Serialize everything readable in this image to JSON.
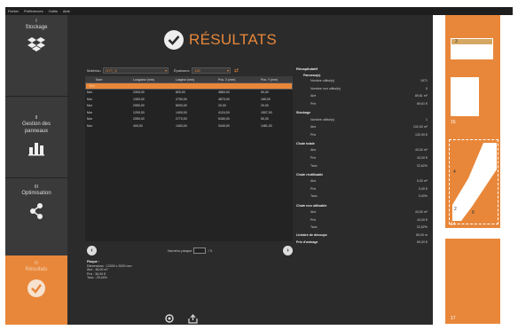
{
  "menubar": [
    "Fichier",
    "Préférences",
    "Outils",
    "Aide"
  ],
  "sidebar": {
    "items": [
      {
        "num": "I",
        "label": "Stockage",
        "icon": "dropbox-box-icon"
      },
      {
        "num": "II",
        "label": "Gestion des panneaux",
        "icon": "bar-chart-icon"
      },
      {
        "num": "III",
        "label": "Optimisation",
        "icon": "share-nodes-icon"
      },
      {
        "num": "IV",
        "label": "Résultats",
        "icon": "check-circle-icon"
      }
    ]
  },
  "header": {
    "title": "RÉSULTATS"
  },
  "filters": {
    "material_label": "Matériau",
    "material_value": "GYT_E",
    "thickness_label": "Épaisseur",
    "thickness_value": "130"
  },
  "table": {
    "columns": [
      "Nom",
      "Longueur (mm)",
      "Largeur (mm)",
      "Pos. X (mm)",
      "Pos. Y (mm)"
    ],
    "rows": [
      [
        "Mur",
        "",
        "",
        "",
        ""
      ],
      [
        "Mur",
        "2300,00",
        "800,00",
        "4860,00",
        "50,00"
      ],
      [
        "Mur",
        "1300,00",
        "2790,00",
        "4870,00",
        "165,00"
      ],
      [
        "Mur",
        "2050,00",
        "8000,00",
        "20,00",
        "20,00"
      ],
      [
        "Mur",
        "1200,00",
        "1400,00",
        "4124,00",
        "1507,00"
      ],
      [
        "Mur",
        "2050,00",
        "2770,00",
        "5180,00",
        "50,00"
      ],
      [
        "Mur",
        "400,00",
        "1400,00",
        "3440,00",
        "1481,00"
      ]
    ],
    "selected_row": 0
  },
  "pager": {
    "label": "Numéro plaque",
    "value": "",
    "total": "/ 3"
  },
  "plaque": {
    "heading": "Plaque :",
    "lines": [
      "Dimensions : 12000 x 3000 mm",
      "Aire : 36,00 m²",
      "Prix : 36,00 €",
      "Taux : 29,44%"
    ]
  },
  "recap": {
    "title": "Récapitulatif",
    "sections": [
      {
        "name": "Panneau(x)",
        "items": [
          {
            "label": "Nombre utilisé(s)",
            "value": "1971"
          },
          {
            "label": "Nombre non utilisé(s)",
            "value": "0"
          },
          {
            "label": "Aire",
            "value": "89,61 m²"
          },
          {
            "label": "Prix",
            "value": "89,61 €"
          }
        ]
      },
      {
        "name": "Stockage",
        "items": [
          {
            "label": "Nombre utilisé(s)",
            "value": "1"
          },
          {
            "label": "Aire",
            "value": "132,00 m²"
          },
          {
            "label": "Prix",
            "value": "132,00 €"
          }
        ]
      },
      {
        "name": "Chute totale",
        "items": [
          {
            "label": "Aire",
            "value": "43,00 m²"
          },
          {
            "label": "Prix",
            "value": "43,00 €"
          },
          {
            "label": "Taux",
            "value": "32,62%"
          }
        ]
      },
      {
        "name": "Chute réutilisable",
        "items": [
          {
            "label": "Aire",
            "value": "0,00 m²"
          },
          {
            "label": "Prix",
            "value": "0,00 €"
          },
          {
            "label": "Taux",
            "value": "0,00%"
          }
        ]
      },
      {
        "name": "Chute non utilisable",
        "items": [
          {
            "label": "Aire",
            "value": "43,00 m²"
          },
          {
            "label": "Prix",
            "value": "43,00 €"
          },
          {
            "label": "Taux",
            "value": "32,62%"
          }
        ]
      }
    ],
    "footer": [
      {
        "label": "Linéaire de découpe",
        "value": "69,00 m"
      },
      {
        "label": "Prix d'usinage",
        "value": "69,00 €"
      }
    ]
  },
  "preview": {
    "labels": [
      "3",
      "15",
      "4",
      "2",
      "8",
      "14",
      "17"
    ]
  },
  "colors": {
    "accent": "#e8873a",
    "sidebar": "#3a3a3a",
    "background": "#2b2b2b"
  }
}
